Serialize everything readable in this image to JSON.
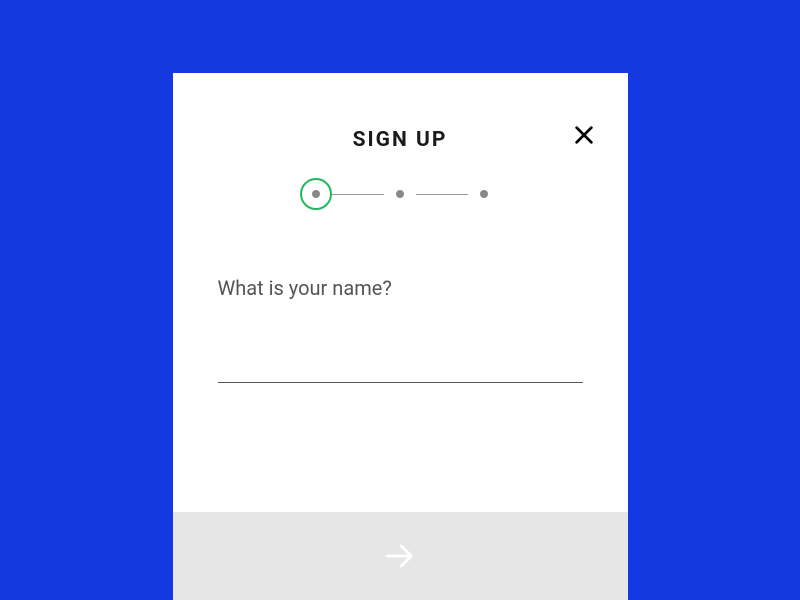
{
  "header": {
    "title": "SIGN UP"
  },
  "stepper": {
    "current": 1,
    "total": 3
  },
  "form": {
    "question": "What is your name?",
    "name_value": ""
  },
  "colors": {
    "background": "#1439e0",
    "card": "#ffffff",
    "accent": "#1fb85c",
    "footer": "#e6e6e6"
  },
  "icons": {
    "close": "close-icon",
    "next": "arrow-right-icon"
  }
}
